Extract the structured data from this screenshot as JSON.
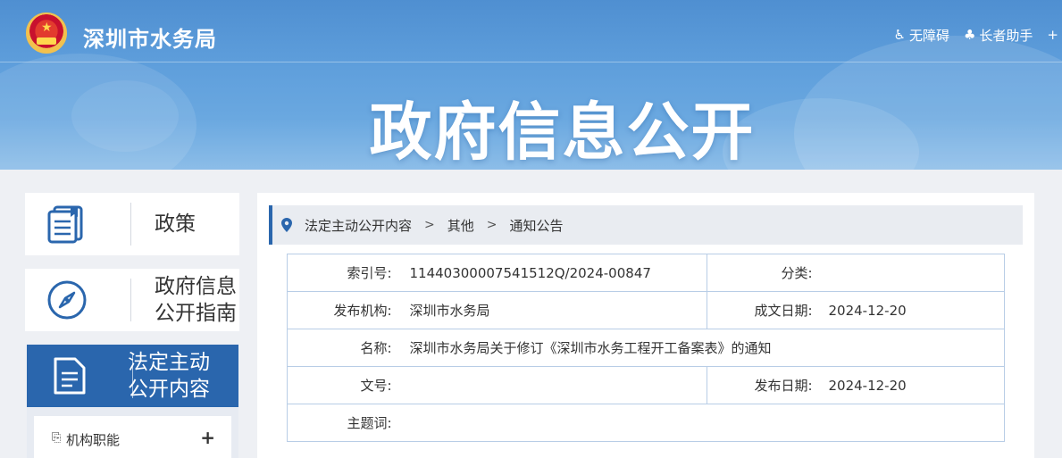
{
  "header": {
    "site_name": "深圳市水务局",
    "banner_title": "政府信息公开",
    "links": [
      {
        "icon": "accessibility-icon",
        "label": "无障碍"
      },
      {
        "icon": "elder-assist-icon",
        "label": "长者助手"
      }
    ]
  },
  "sidebar": {
    "items": [
      {
        "icon": "policy-book-icon",
        "label": "政策"
      },
      {
        "icon": "compass-icon",
        "label": "政府信息\n公开指南"
      },
      {
        "icon": "document-icon",
        "label": "法定主动\n公开内容",
        "active": true
      }
    ],
    "sub_items": [
      {
        "label": "机构职能",
        "expand": "+"
      }
    ]
  },
  "breadcrumb": {
    "items": [
      "法定主动公开内容",
      "其他",
      "通知公告"
    ]
  },
  "info": {
    "index_label": "索引号:",
    "index_value": "11440300007541512Q/2024-00847",
    "category_label": "分类:",
    "category_value": "",
    "org_label": "发布机构:",
    "org_value": "深圳市水务局",
    "created_label": "成文日期:",
    "created_value": "2024-12-20",
    "name_label": "名称:",
    "name_value": "深圳市水务局关于修订《深圳市水务工程开工备案表》的通知",
    "doc_no_label": "文号:",
    "doc_no_value": "",
    "published_label": "发布日期:",
    "published_value": "2024-12-20",
    "keywords_label": "主题词:",
    "keywords_value": ""
  },
  "colors": {
    "accent": "#2a66ad",
    "header": "#5f9fdc",
    "table_border": "#b8cde6"
  }
}
